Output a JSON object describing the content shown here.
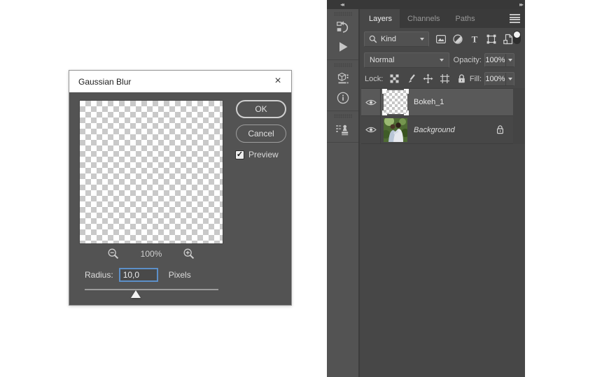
{
  "dialog": {
    "title": "Gaussian Blur",
    "close_glyph": "×",
    "buttons": {
      "ok": "OK",
      "cancel": "Cancel"
    },
    "preview_checkbox": {
      "label": "Preview",
      "checked": true,
      "check_glyph": "✓"
    },
    "zoom": {
      "level": "100%",
      "out_icon": "magnifier-minus-icon",
      "in_icon": "magnifier-plus-icon"
    },
    "radius": {
      "label": "Radius:",
      "value": "10,0",
      "unit": "Pixels"
    },
    "slider": {
      "position_percent": 40
    }
  },
  "panel": {
    "collapse_left_glyph": "◂◂",
    "collapse_right_glyph": "▸▸",
    "dock_icons": [
      "history-panel-icon",
      "actions-panel-icon",
      "tool-presets-panel-icon",
      "info-panel-icon",
      "layer-comps-panel-icon"
    ],
    "tabs": {
      "layers": "Layers",
      "channels": "Channels",
      "paths": "Paths",
      "active": "Layers"
    },
    "menu_icon": "hamburger-menu-icon",
    "filter_row": {
      "search_icon": "magnifier-icon",
      "kind_label": "Kind",
      "filter_icons": [
        "pixel-layer-filter-icon",
        "adjustment-layer-filter-icon",
        "type-layer-filter-icon",
        "shape-layer-filter-icon",
        "smart-object-filter-icon"
      ],
      "toggle_icon": "layer-filter-toggle-icon"
    },
    "blend_row": {
      "mode": "Normal",
      "opacity_label": "Opacity:",
      "opacity_value": "100%"
    },
    "lock_row": {
      "label": "Lock:",
      "lock_icons": [
        "lock-transparency-icon",
        "lock-pixels-icon",
        "lock-position-icon",
        "lock-artboard-icon",
        "lock-all-icon"
      ],
      "fill_label": "Fill:",
      "fill_value": "100%"
    },
    "layers": [
      {
        "name": "Bokeh_1",
        "visible": true,
        "selected": true,
        "thumbnail": "transparent-checkerboard"
      },
      {
        "name": "Background",
        "visible": true,
        "selected": false,
        "locked": true,
        "italic": true,
        "thumbnail": "photo"
      }
    ]
  },
  "colors": {
    "page_bg": "#ffffff",
    "dialog_bg": "#535353",
    "titlebar_bg": "#ffffff",
    "panel_bg": "#474747",
    "dock_bg": "#535353",
    "tabbar_bg": "#3a3a3a",
    "selected_row_bg": "#595959",
    "focus_border": "#5c8fc8",
    "icon_color": "#c6c6c6"
  }
}
